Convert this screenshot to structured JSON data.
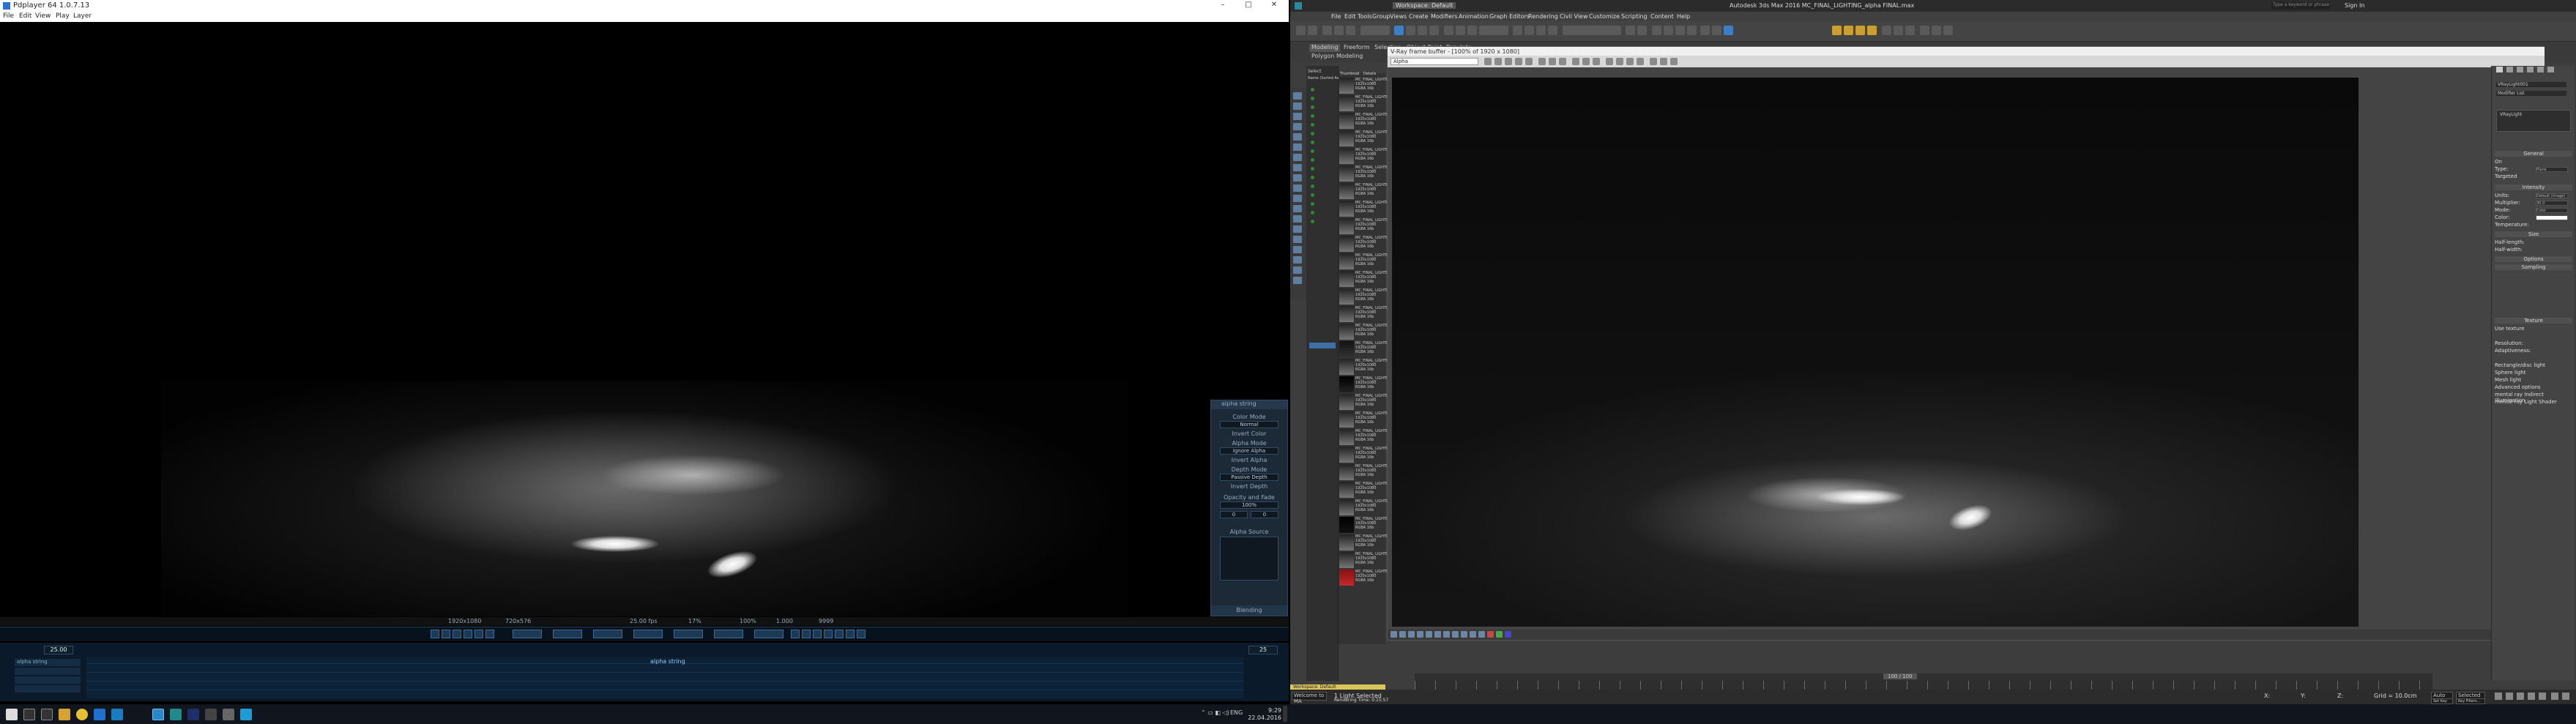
{
  "djv": {
    "title": "Pdplayer 64 1.0.7.13",
    "menu": [
      "File",
      "Edit",
      "View",
      "Play",
      "Layer"
    ],
    "window_buttons": [
      "–",
      "□",
      "✕"
    ],
    "infobar": [
      "1920x1080",
      "720x576",
      "25.00 fps",
      "17%",
      "100%",
      "1.000",
      "9999"
    ],
    "frame_start": "25.00",
    "frame_end": "25",
    "layers": [
      "alpha string",
      "",
      "",
      ""
    ],
    "timeline_label": "alpha string",
    "alpha_panel": {
      "header": "alpha string",
      "color_mode_label": "Color Mode",
      "color_mode": "Normal",
      "invert_color": "Invert Color",
      "alpha_mode_label": "Alpha Mode",
      "alpha_mode": "Ignore Alpha",
      "invert_alpha": "Invert Alpha",
      "depth_mode_label": "Depth Mode",
      "depth_mode": "Passive Depth",
      "invert_depth": "Invert Depth",
      "opacity_label": "Opacity and Fade",
      "opacity": "100%",
      "fade_in": "0",
      "fade_out": "0",
      "alpha_source_label": "Alpha Source",
      "blending_label": "Blending"
    }
  },
  "max": {
    "title": "Autodesk 3ds Max 2016   MC_FINAL_LIGHTING_alpha FINAL.max",
    "workspace": "Workspace: Default",
    "search_placeholder": "Type a keyword or phrase",
    "sign_in": "Sign In",
    "menu": [
      "File",
      "Edit",
      "Tools",
      "Group",
      "Views",
      "Create",
      "Modifiers",
      "Animation",
      "Graph Editors",
      "Rendering",
      "Civil View",
      "Customize",
      "Scripting",
      "Content",
      "Help"
    ],
    "ribbon_tabs": [
      "Modeling",
      "Freeform",
      "Selection",
      "Object Paint",
      "Populate"
    ],
    "ribbon_sub": "Polygon Modeling",
    "explorer_tabs": [
      "Select",
      "Display",
      "Edit"
    ],
    "explorer_header": [
      "Name (Sorted Ascending)"
    ],
    "thumb_header": [
      "Thumbnail",
      "Details"
    ],
    "thumb_label": "MC_FINAL_LIGHTING_alpha",
    "thumb_sub": "1920x1080 RGBA 16b",
    "framebuffer_title": "V-Ray frame buffer - [100% of 1920 x 1080]",
    "framebuffer_channel": "Alpha",
    "cmd_panel": {
      "object_name": "VRayLight001",
      "modifier_list": "Modifier List",
      "stack_item": "VRayLight",
      "sections": [
        "General",
        "On",
        "Type:",
        "Targeted",
        "Intensity",
        "Units:",
        "Multiplier:",
        "Mode:",
        "Color:",
        "Temperature:",
        "Size",
        "Half-length:",
        "Half-width:",
        "Options",
        "Sampling",
        "Texture",
        "Use texture",
        "Resolution:",
        "Adaptiveness:",
        "Rectangle/disc light",
        "Sphere light",
        "Mesh light",
        "Advanced options",
        "mental ray Indirect Illumination",
        "mental ray Light Shader"
      ],
      "values": {
        "type": "Plane",
        "units": "Default (image)",
        "multiplier": "30.0",
        "mode": "Color"
      }
    },
    "time_label": "100 / 100",
    "status_left": "1 Light Selected",
    "status_prompt": "Rendering Time: 0:15:57",
    "status_script": "Welcome to MA",
    "coords": {
      "x": "X:",
      "y": "Y:",
      "z": "Z:",
      "grid": "Grid = 10.0cm"
    },
    "auto_key": "Auto Key",
    "set_key": "Set Key",
    "key_mode": "Selected",
    "key_filters": "Key Filters..."
  },
  "taskbar": {
    "time": "9:29",
    "date": "22.04.2016",
    "lang": "ENG"
  }
}
